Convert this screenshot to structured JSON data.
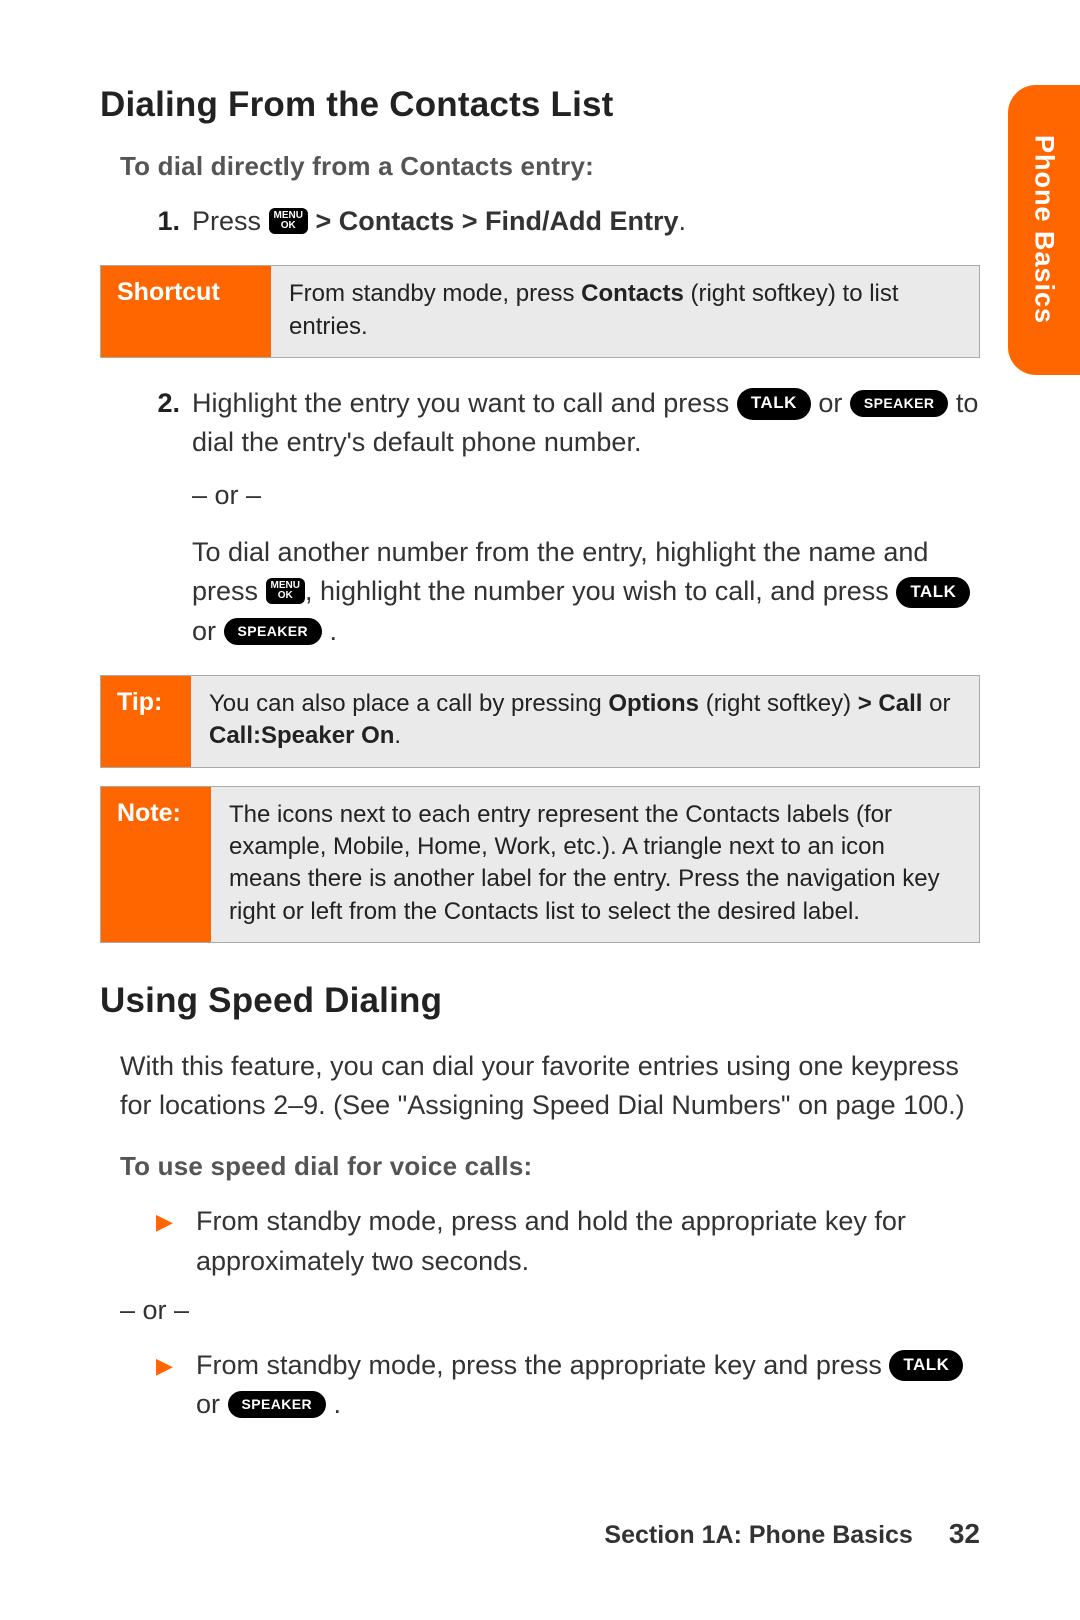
{
  "sideTab": "Phone Basics",
  "h1a": "Dialing From the Contacts List",
  "sub1": "To dial directly from a Contacts entry:",
  "step1_num": "1.",
  "step1_a": "Press ",
  "menu_top": "MENU",
  "menu_bot": "OK",
  "step1_b": " > Contacts > Find/Add Entry",
  "step1_c": ".",
  "shortcut_label": "Shortcut",
  "shortcut_a": "From standby mode, press ",
  "shortcut_b": "Contacts",
  "shortcut_c": " (right softkey) to list entries.",
  "step2_num": "2.",
  "step2_a": "Highlight the entry you want to call and press ",
  "talk": "TALK",
  "step2_b": " or ",
  "speaker": "SPEAKER",
  "step2_c": " to dial the entry's default phone number.",
  "or": "– or –",
  "step2_d": "To dial another number from the entry, highlight the name and press ",
  "step2_e": ", highlight the number you wish to call, and press ",
  "step2_f": " or ",
  "step2_g": " .",
  "tip_label": "Tip:",
  "tip_a": "You can also place a call by pressing ",
  "tip_b": "Options",
  "tip_c": " (right softkey) ",
  "tip_d": "> Call",
  "tip_e": " or ",
  "tip_f": "Call:Speaker On",
  "tip_g": ".",
  "note_label": "Note:",
  "note_body": "The icons next to each entry represent the Contacts labels (for example, Mobile, Home, Work, etc.). A triangle next to an icon means there is another label for the entry. Press the navigation key right or left from the Contacts list to select the desired label.",
  "h1b": "Using Speed Dialing",
  "speed_intro": "With this feature, you can dial your favorite entries using one keypress for locations 2–9. (See \"Assigning Speed Dial Numbers\" on page 100.)",
  "sub2": "To use speed dial for voice calls:",
  "b1": "From standby mode, press and hold the appropriate key for approximately two seconds.",
  "b2_a": "From standby mode, press the appropriate key and press ",
  "b2_b": " or ",
  "b2_c": " .",
  "footer_section": "Section 1A: Phone Basics",
  "footer_page": "32"
}
